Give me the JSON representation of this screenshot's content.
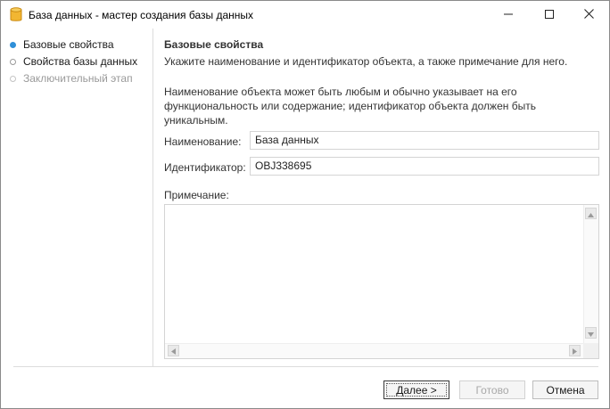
{
  "window": {
    "title": "База данных - мастер создания базы данных",
    "icon": "database-icon",
    "accent_color": "#2f8fd8"
  },
  "steps": [
    {
      "label": "Базовые свойства",
      "state": "active"
    },
    {
      "label": "Свойства базы данных",
      "state": "pending"
    },
    {
      "label": "Заключительный этап",
      "state": "disabled"
    }
  ],
  "page": {
    "title": "Базовые свойства",
    "subtitle": "Укажите наименование и идентификатор объекта, а также примечание для него.",
    "description": "Наименование объекта может быть любым и обычно указывает на его функциональность или содержание; идентификатор объекта должен быть уникальным."
  },
  "form": {
    "name_label": "Наименование:",
    "name_value": "База данных",
    "id_label": "Идентификатор:",
    "id_value": "OBJ338695",
    "notes_label": "Примечание:",
    "notes_value": ""
  },
  "buttons": {
    "next": "Далее >",
    "finish": "Готово",
    "cancel": "Отмена"
  }
}
